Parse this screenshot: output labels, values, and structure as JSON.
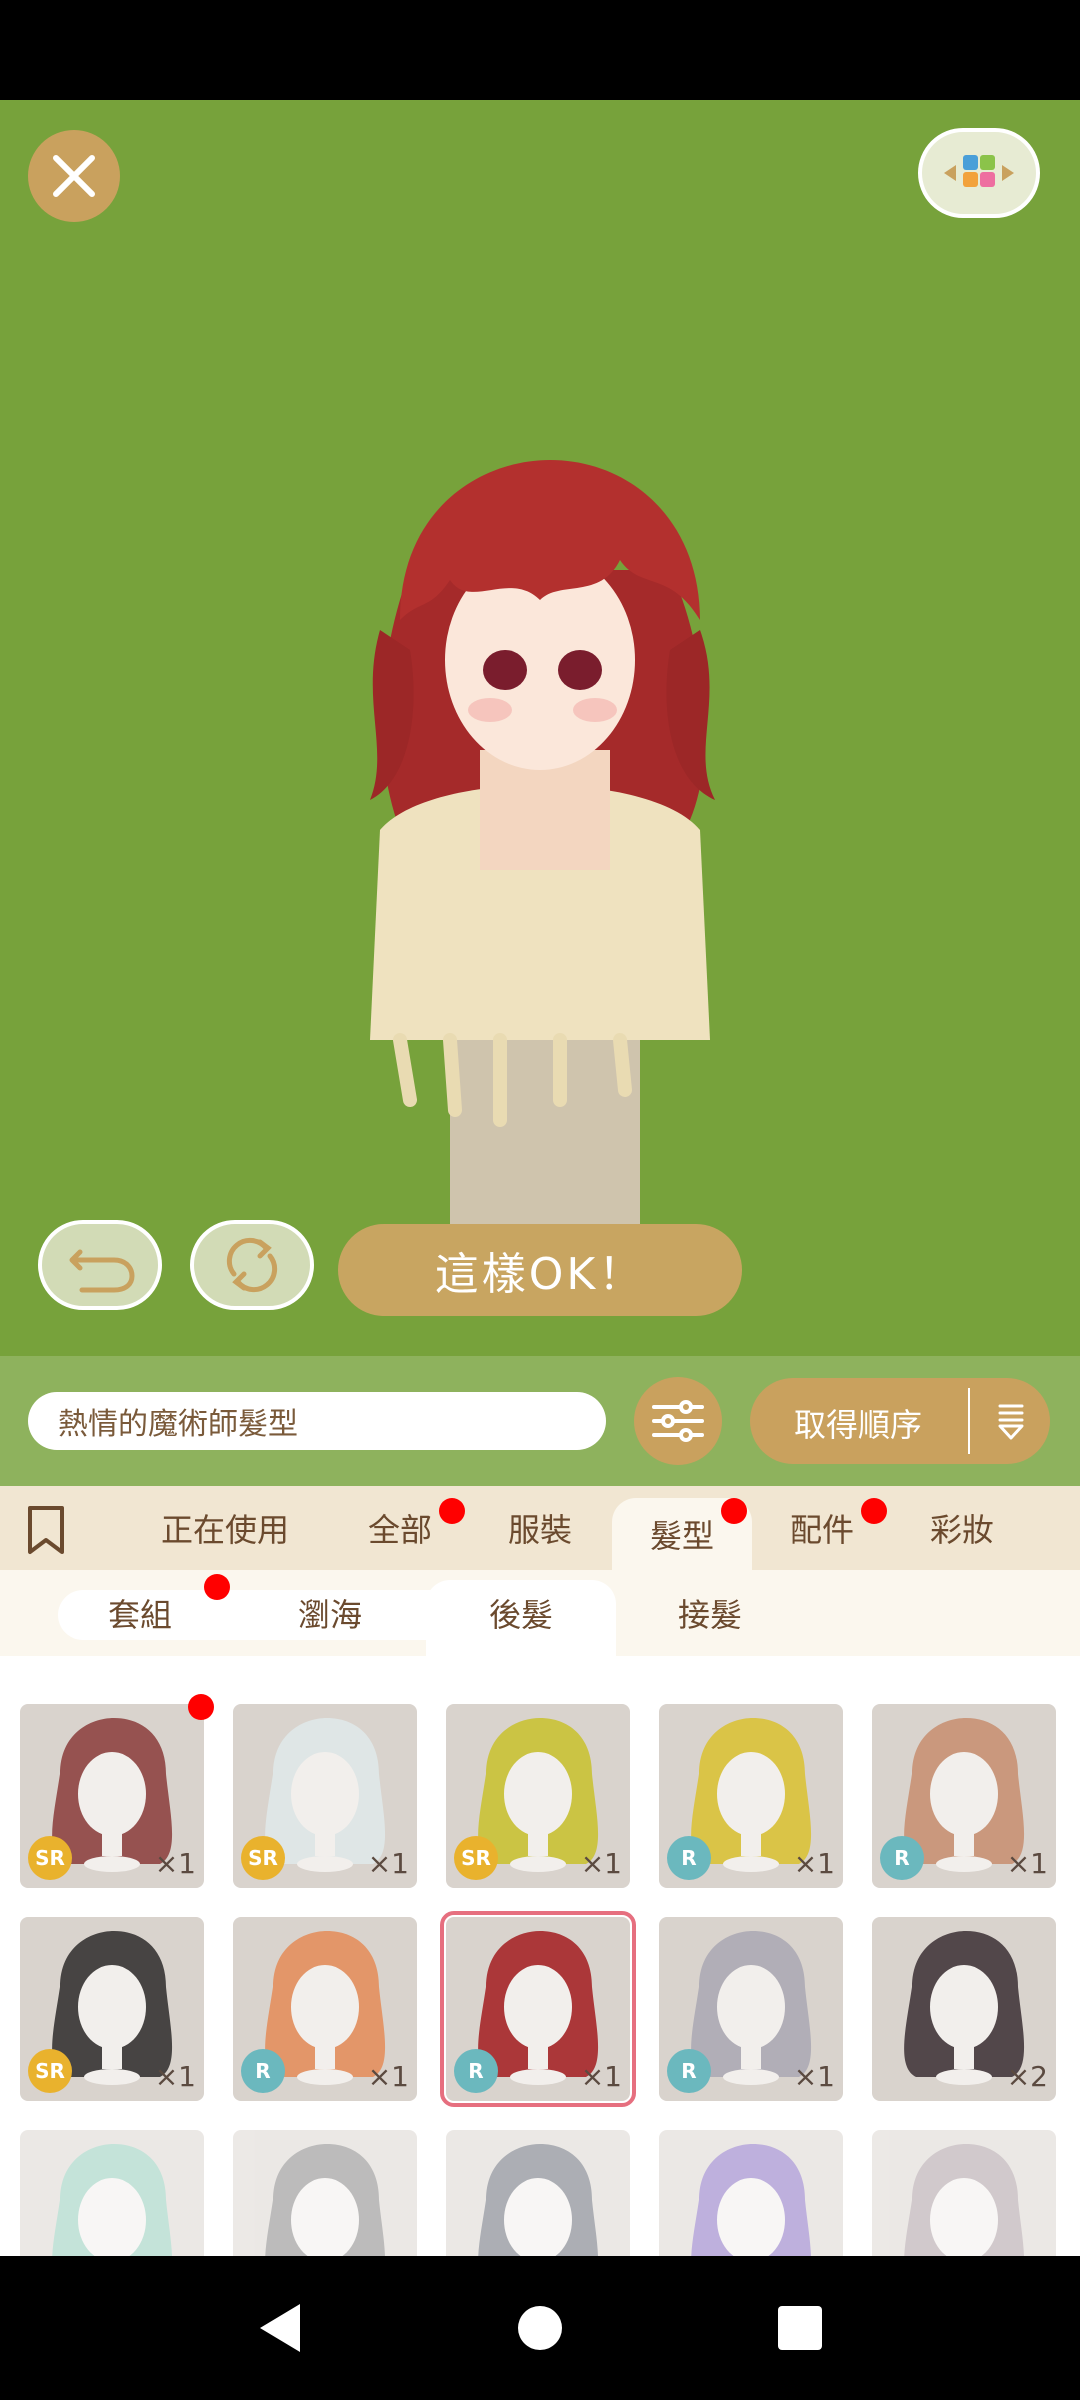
{
  "title": "",
  "colors": {
    "stage_bg": "#77a23b",
    "gold": "#c9a15e",
    "tab_bg": "#f1e6d2",
    "selected_outline": "#e66f7f",
    "notification": "#ff0000"
  },
  "icons": {
    "close": "close-icon",
    "palette": "palette-icon",
    "undo": "undo-icon",
    "refresh": "refresh-icon",
    "filter": "sliders-icon",
    "sort": "sort-icon",
    "bookmark": "bookmark-icon"
  },
  "stage": {
    "ok_button": "這樣OK！"
  },
  "search": {
    "value": "熱情的魔術師髮型",
    "sort_label": "取得順序"
  },
  "tabs": [
    {
      "label": "正在使用",
      "active": false,
      "dot": false
    },
    {
      "label": "全部",
      "active": false,
      "dot": true
    },
    {
      "label": "服裝",
      "active": false,
      "dot": false
    },
    {
      "label": "髮型",
      "active": true,
      "dot": true
    },
    {
      "label": "配件",
      "active": false,
      "dot": true
    },
    {
      "label": "彩妝",
      "active": false,
      "dot": false
    }
  ],
  "subtabs": [
    {
      "label": "套組",
      "active": false,
      "dot": true
    },
    {
      "label": "瀏海",
      "active": false,
      "dot": false
    },
    {
      "label": "後髮",
      "active": true,
      "dot": false
    },
    {
      "label": "接髮",
      "active": false,
      "dot": false
    }
  ],
  "items": [
    {
      "rarity": "SR",
      "qty": "×1",
      "dot": true,
      "hair": "#8a3b3a"
    },
    {
      "rarity": "SR",
      "qty": "×1",
      "dot": false,
      "hair": "#dfe9ea"
    },
    {
      "rarity": "SR",
      "qty": "×1",
      "dot": false,
      "hair": "#c8c12b"
    },
    {
      "rarity": "R",
      "qty": "×1",
      "dot": false,
      "hair": "#d9c12f"
    },
    {
      "rarity": "R",
      "qty": "×1",
      "dot": false,
      "hair": "#c78d6f"
    },
    {
      "rarity": "SR",
      "qty": "×1",
      "dot": false,
      "hair": "#2d2a2a"
    },
    {
      "rarity": "R",
      "qty": "×1",
      "dot": false,
      "hair": "#e48b57"
    },
    {
      "rarity": "R",
      "qty": "×1",
      "dot": false,
      "hair": "#a21b1e",
      "selected": true
    },
    {
      "rarity": "R",
      "qty": "×1",
      "dot": false,
      "hair": "#a9a7b3"
    },
    {
      "rarity": "",
      "qty": "×2",
      "dot": false,
      "hair": "#3a2e33"
    },
    {
      "rarity": "",
      "qty": "",
      "dot": false,
      "hair": "#7bc6b0",
      "faded": true
    },
    {
      "rarity": "",
      "qty": "",
      "dot": false,
      "hair": "#6a6a6a",
      "faded": true
    },
    {
      "rarity": "",
      "qty": "",
      "dot": false,
      "hair": "#444b5a",
      "faded": true
    },
    {
      "rarity": "",
      "qty": "",
      "dot": false,
      "hair": "#6f4fb8",
      "faded": true
    },
    {
      "rarity": "",
      "qty": "",
      "dot": false,
      "hair": "#9b8a90",
      "faded": true
    }
  ]
}
